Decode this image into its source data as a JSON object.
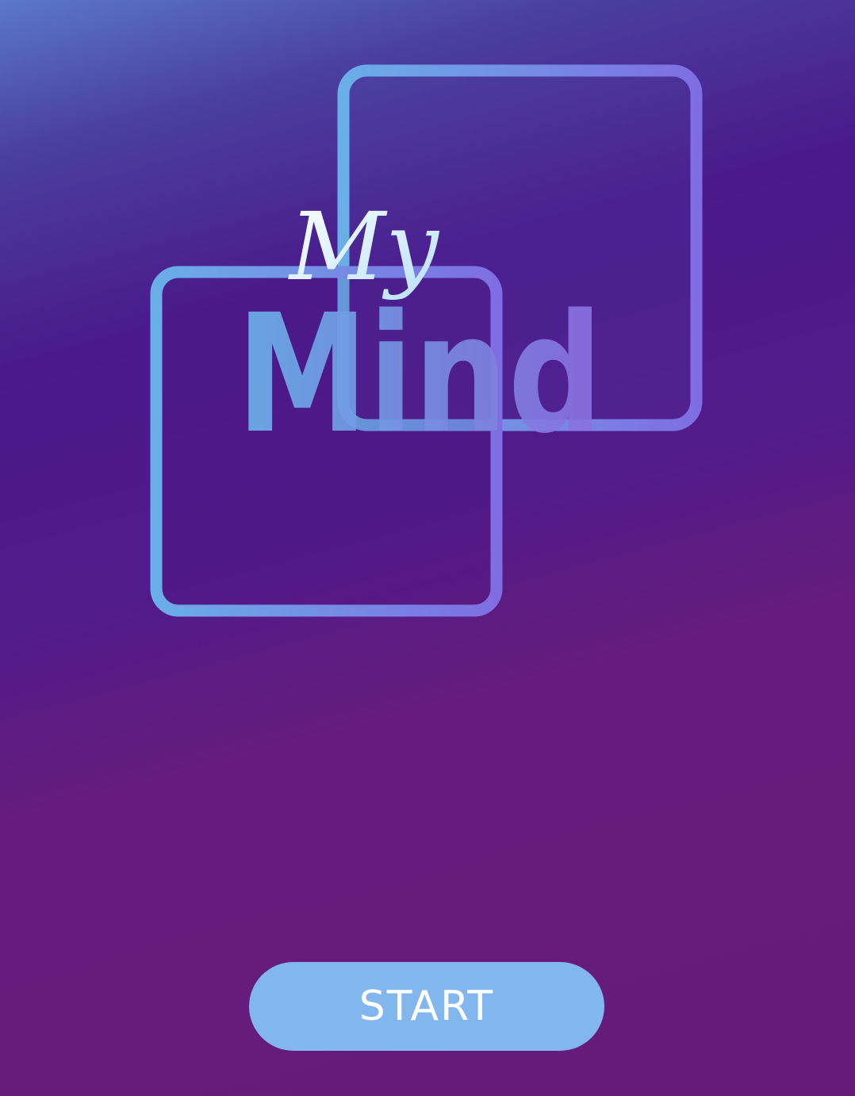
{
  "logo": {
    "script_word": "My",
    "main_word": "Mind"
  },
  "start_button": {
    "label": "START"
  },
  "colors": {
    "background_top": "#4a1a8c",
    "background_bottom": "#661b7a",
    "frame_gradient_start": "#6aaee8",
    "frame_gradient_end": "#7b6ee0",
    "button": "#82b7ee",
    "button_text": "#ffffff"
  }
}
